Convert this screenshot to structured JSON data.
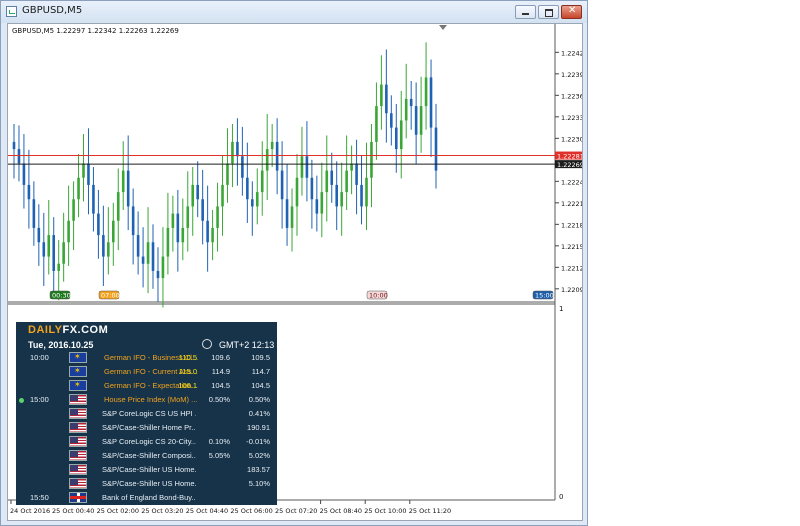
{
  "window": {
    "title": "GBPUSD,M5"
  },
  "chart_data": {
    "type": "candlestick",
    "symbol_line": "GBPUSD,M5  1.22297 1.22342 1.22263 1.22269",
    "price_axis": {
      "ticks": [
        "1.22425",
        "1.22395",
        "1.22365",
        "1.22335",
        "1.22305",
        "1.22245",
        "1.22215",
        "1.22185",
        "1.22155",
        "1.22125",
        "1.22095"
      ],
      "range": [
        1.22085,
        1.22445
      ]
    },
    "price_labels": [
      {
        "name": "red-level",
        "value": "1.22281",
        "price": 1.22281,
        "color": "#e0302a"
      },
      {
        "name": "bid",
        "value": "1.22269",
        "price": 1.22269,
        "color": "#1c1c1c"
      }
    ],
    "session_markers": [
      {
        "text": "00:30",
        "bg": "#1f7a1f",
        "fg": "#ffffff"
      },
      {
        "text": "07:00",
        "bg": "#f3a21b",
        "fg": "#ffffff"
      },
      {
        "text": "10:00",
        "bg": "#f2dada",
        "fg": "#7a1010"
      },
      {
        "text": "15:00",
        "bg": "#1f5fa8",
        "fg": "#ffffff"
      }
    ],
    "time_axis": [
      "24 Oct 2016",
      "25 Oct 00:40",
      "25 Oct 02:00",
      "25 Oct 03:20",
      "25 Oct 04:40",
      "25 Oct 06:00",
      "25 Oct 07:20",
      "25 Oct 08:40",
      "25 Oct 10:00",
      "25 Oct 11:20"
    ],
    "lower_panel_axis": {
      "top": "1",
      "bottom": "0"
    },
    "up_color": "#3aa636",
    "down_color": "#1f62b4",
    "series": [
      1.2229,
      1.2227,
      1.2224,
      1.2222,
      1.2218,
      1.2216,
      1.2214,
      1.2217,
      1.2212,
      1.2213,
      1.2216,
      1.2219,
      1.2222,
      1.2225,
      1.2227,
      1.2224,
      1.222,
      1.2217,
      1.2214,
      1.2216,
      1.2219,
      1.2223,
      1.2226,
      1.2221,
      1.2217,
      1.2214,
      1.2213,
      1.2216,
      1.2212,
      1.2211,
      1.2214,
      1.2218,
      1.222,
      1.2216,
      1.2218,
      1.2221,
      1.2224,
      1.2222,
      1.2219,
      1.2216,
      1.2218,
      1.2221,
      1.2224,
      1.2227,
      1.223,
      1.2228,
      1.2225,
      1.2222,
      1.2221,
      1.2223,
      1.2226,
      1.2229,
      1.223,
      1.2226,
      1.2222,
      1.2218,
      1.2221,
      1.2225,
      1.2228,
      1.2225,
      1.2222,
      1.222,
      1.2223,
      1.2226,
      1.2224,
      1.2221,
      1.2223,
      1.2226,
      1.2227,
      1.2224,
      1.2221,
      1.2225,
      1.223,
      1.2235,
      1.2238,
      1.2234,
      1.2232,
      1.2229,
      1.2233,
      1.2236,
      1.2235,
      1.2231,
      1.2235,
      1.2239,
      1.2232,
      1.2226
    ]
  },
  "dailyfx": {
    "brand_accent": "DAILY",
    "brand_rest": "FX.COM",
    "date": "Tue, 2016.10.25",
    "timezone": "GMT+2 12:13",
    "events": [
      {
        "time": "10:00",
        "flag": "eu",
        "event": "German IFO - Business Cl...",
        "orange": true,
        "actual": "110.5",
        "forecast": "109.6",
        "previous": "109.5"
      },
      {
        "time": "",
        "flag": "eu",
        "event": "German IFO - Current Ass...",
        "orange": true,
        "actual": "115.0",
        "forecast": "114.9",
        "previous": "114.7"
      },
      {
        "time": "",
        "flag": "eu",
        "event": "German IFO - Expectation...",
        "orange": true,
        "actual": "106.1",
        "forecast": "104.5",
        "previous": "104.5"
      },
      {
        "time": "15:00",
        "flag": "us",
        "event": "House Price Index (MoM) ...",
        "orange": true,
        "actual": "",
        "forecast": "0.50%",
        "previous": "0.50%",
        "dot": true
      },
      {
        "time": "",
        "flag": "us",
        "event": "S&P CoreLogic CS US HPI ...",
        "orange": false,
        "actual": "",
        "forecast": "",
        "previous": "0.41%"
      },
      {
        "time": "",
        "flag": "us",
        "event": "S&P/Case-Shiller Home Pr...",
        "orange": false,
        "actual": "",
        "forecast": "",
        "previous": "190.91"
      },
      {
        "time": "",
        "flag": "us",
        "event": "S&P CoreLogic CS 20-City...",
        "orange": false,
        "actual": "",
        "forecast": "0.10%",
        "previous": "-0.01%"
      },
      {
        "time": "",
        "flag": "us",
        "event": "S&P/Case-Shiller Composi...",
        "orange": false,
        "actual": "",
        "forecast": "5.05%",
        "previous": "5.02%"
      },
      {
        "time": "",
        "flag": "us",
        "event": "S&P/Case-Shiller US Home...",
        "orange": false,
        "actual": "",
        "forecast": "",
        "previous": "183.57"
      },
      {
        "time": "",
        "flag": "us",
        "event": "S&P/Case-Shiller US Home...",
        "orange": false,
        "actual": "",
        "forecast": "",
        "previous": "5.10%"
      },
      {
        "time": "15:50",
        "flag": "uk",
        "event": "Bank of England Bond-Buy...",
        "orange": false,
        "actual": "",
        "forecast": "",
        "previous": ""
      }
    ]
  }
}
